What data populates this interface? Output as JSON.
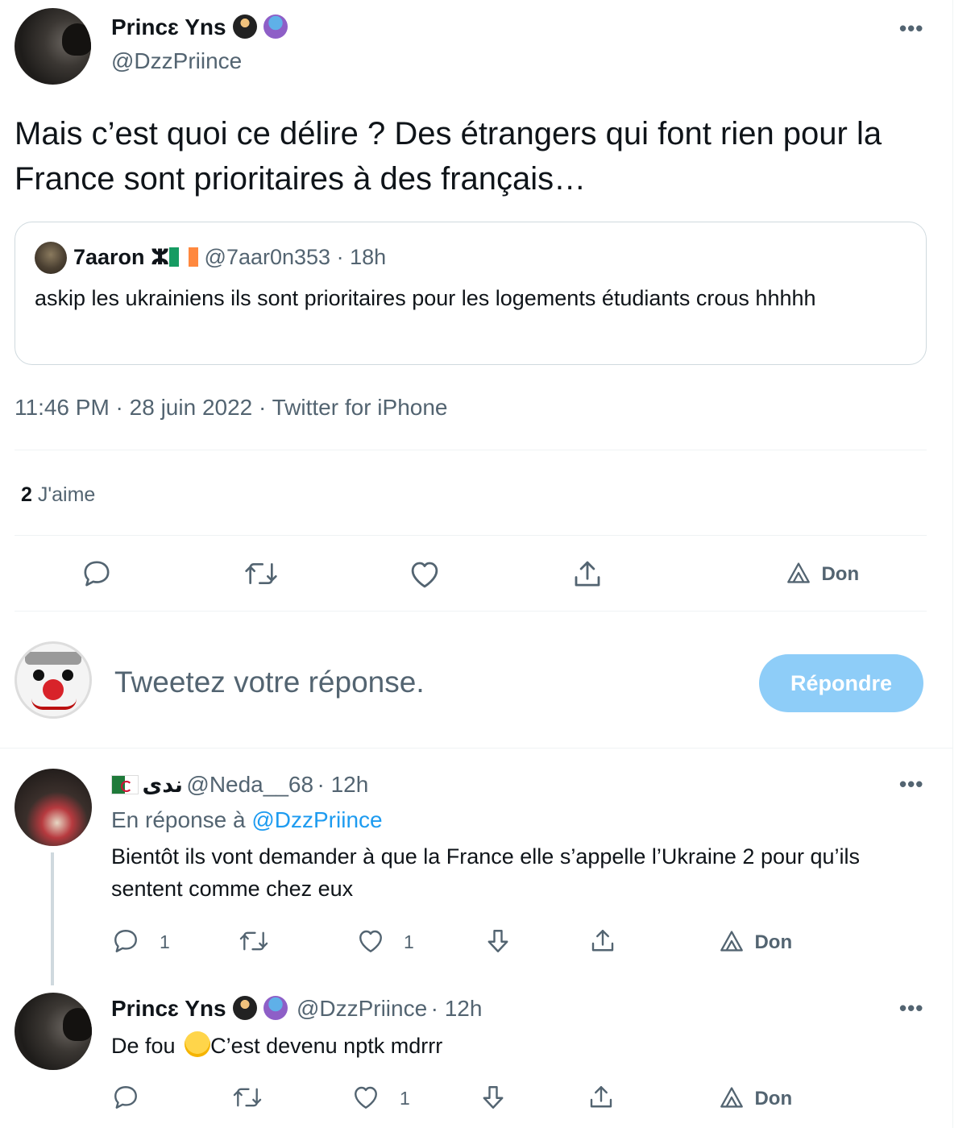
{
  "tweet": {
    "author_name": "Princɛ Yns",
    "author_handle": "@DzzPriince",
    "text": "Mais c’est quoi ce délire ? Des étrangers qui font rien pour la France sont prioritaires à des français…",
    "timestamp": "11:46 PM · 28 juin 2022 · Twitter for iPhone",
    "likes_count": "2",
    "likes_label": "J'aime"
  },
  "quote": {
    "author_name": "7aaron",
    "symbol": "ⵣ",
    "author_handle": "@7aar0n353",
    "time": "· 18h",
    "text": "askip les ukrainiens ils sont prioritaires pour les logements étudiants crous hhhhh"
  },
  "actions": {
    "don_label": "Don"
  },
  "composer": {
    "placeholder": "Tweetez votre réponse.",
    "reply_button": "Répondre"
  },
  "replies": [
    {
      "author_name": "ندى",
      "author_handle": "@Neda__68",
      "time": "· 12h",
      "in_reply_prefix": "En réponse à",
      "in_reply_handle": "@DzzPriince",
      "text": "Bientôt ils vont demander à que la France elle s’appelle l’Ukraine 2 pour qu’ils sentent comme chez eux",
      "reply_count": "1",
      "like_count": "1",
      "don_label": "Don"
    },
    {
      "author_name": "Princɛ Yns",
      "author_handle": "@DzzPriince",
      "time": "· 12h",
      "text_before": "De fou",
      "emoji": "😭",
      "text_after": "C’est devenu nptk mdrrr",
      "like_count": "1",
      "don_label": "Don"
    }
  ],
  "colors": {
    "accent": "#1d9bf0",
    "reply_button_disabled": "#8ecdf8",
    "secondary_text": "#536471",
    "border": "#cfd9de"
  }
}
